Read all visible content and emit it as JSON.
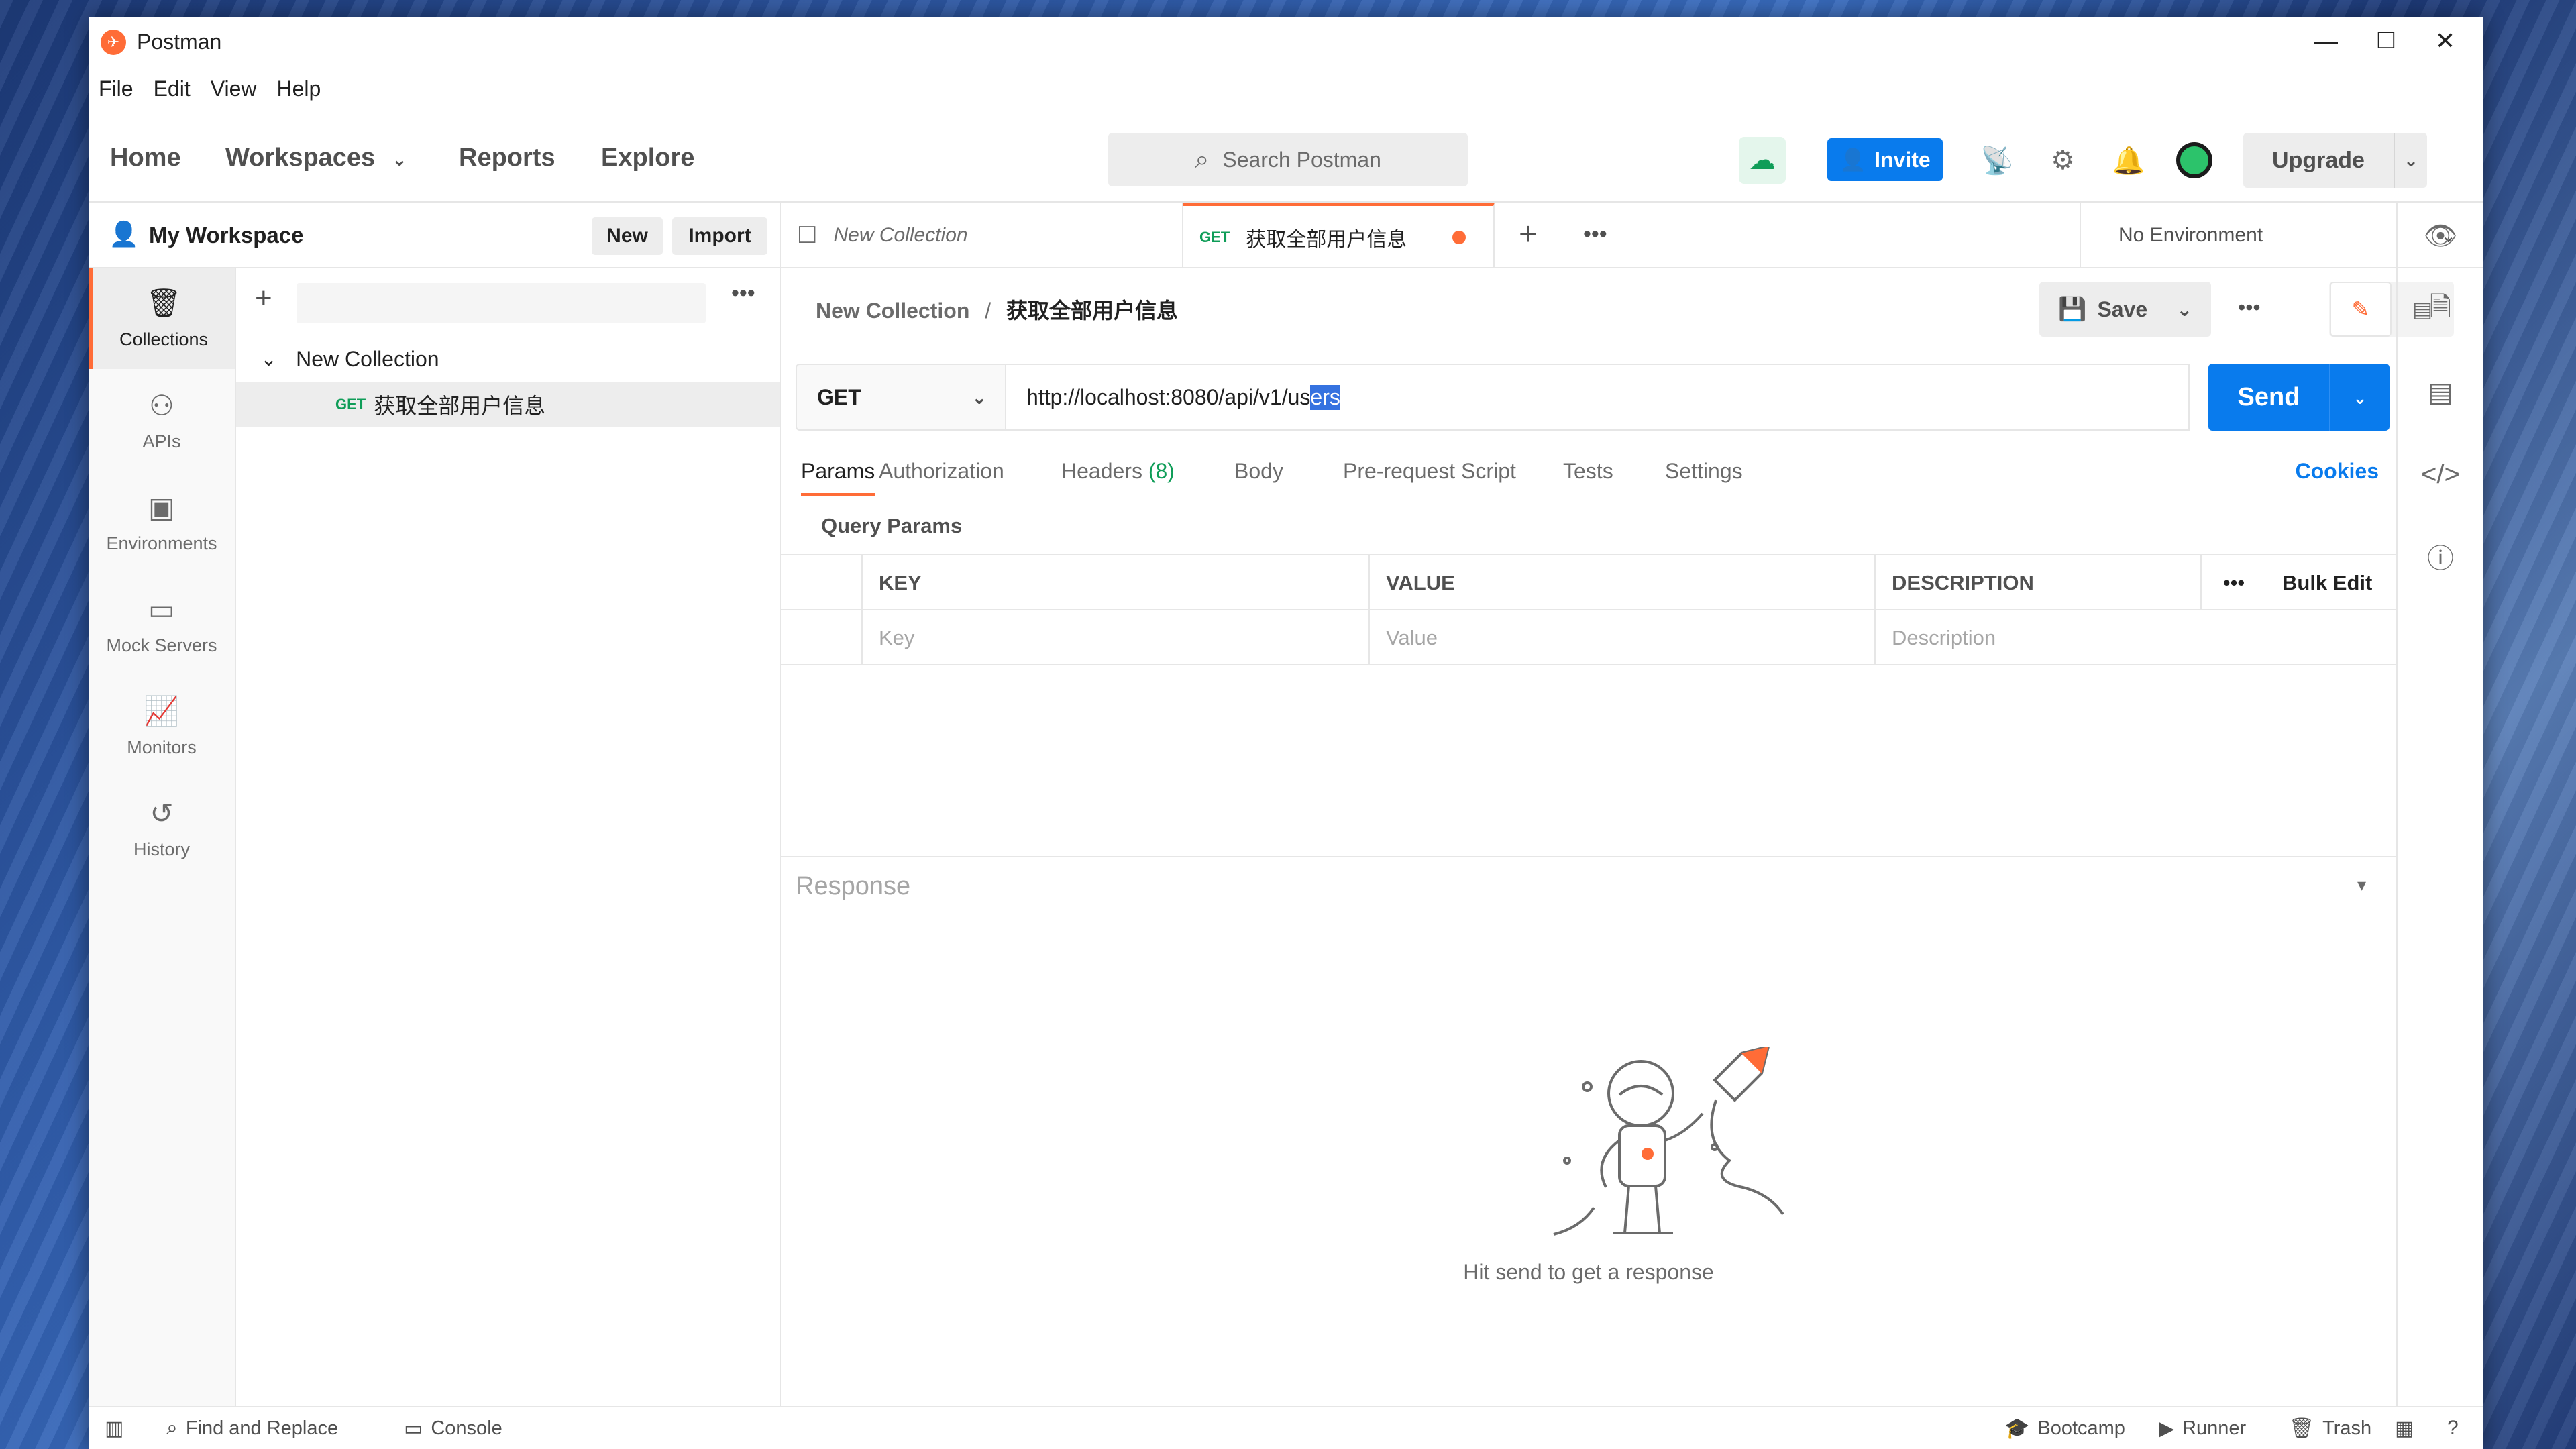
{
  "window": {
    "title": "Postman",
    "minimize": "—",
    "maximize": "☐",
    "close": "✕"
  },
  "menu": [
    "File",
    "Edit",
    "View",
    "Help"
  ],
  "header": {
    "nav": [
      "Home",
      "Workspaces",
      "Reports",
      "Explore"
    ],
    "search_placeholder": "Search Postman",
    "invite_label": "Invite",
    "upgrade_label": "Upgrade"
  },
  "workspace": {
    "title": "My Workspace",
    "new_label": "New",
    "import_label": "Import"
  },
  "rail": [
    {
      "label": "Collections",
      "icon": "collections-icon"
    },
    {
      "label": "APIs",
      "icon": "apis-icon"
    },
    {
      "label": "Environments",
      "icon": "environments-icon"
    },
    {
      "label": "Mock Servers",
      "icon": "mock-servers-icon"
    },
    {
      "label": "Monitors",
      "icon": "monitors-icon"
    },
    {
      "label": "History",
      "icon": "history-icon"
    }
  ],
  "sidebar": {
    "collection_name": "New Collection",
    "request": {
      "method": "GET",
      "name": "获取全部用户信息"
    }
  },
  "tabs": [
    {
      "label": "New Collection"
    },
    {
      "method": "GET",
      "label": "获取全部用户信息"
    }
  ],
  "environment": {
    "selected": "No Environment"
  },
  "request": {
    "breadcrumb_parent": "New Collection",
    "breadcrumb_sep": "/",
    "breadcrumb_current": "获取全部用户信息",
    "save_label": "Save",
    "method": "GET",
    "url_prefix": "http://localhost:8080/api/v1/us",
    "url_selected": "ers",
    "send_label": "Send",
    "tabs": [
      "Params",
      "Authorization",
      "Headers",
      "Body",
      "Pre-request Script",
      "Tests",
      "Settings"
    ],
    "headers_count": "(8)",
    "cookies_label": "Cookies",
    "query_params_title": "Query Params",
    "columns": [
      "KEY",
      "VALUE",
      "DESCRIPTION"
    ],
    "bulk_edit_label": "Bulk Edit",
    "placeholders": {
      "key": "Key",
      "value": "Value",
      "description": "Description"
    }
  },
  "response": {
    "title": "Response",
    "empty_message": "Hit send to get a response"
  },
  "statusbar": {
    "find_replace": "Find and Replace",
    "console": "Console",
    "bootcamp": "Bootcamp",
    "runner": "Runner",
    "trash": "Trash"
  },
  "colors": {
    "accent": "#ff6c37",
    "primary": "#097bed",
    "get_method": "#0f9d58"
  }
}
